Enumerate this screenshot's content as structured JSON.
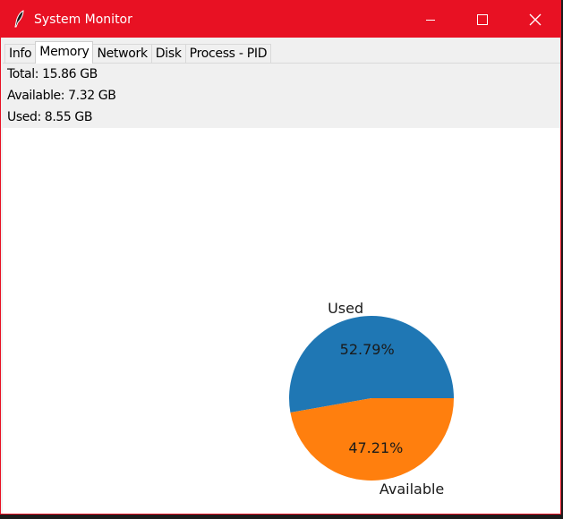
{
  "window": {
    "title": "System Monitor",
    "titlebar_color": "#e81123"
  },
  "tabs": [
    {
      "label": "Info",
      "active": false
    },
    {
      "label": "Memory",
      "active": true
    },
    {
      "label": "Network",
      "active": false
    },
    {
      "label": "Disk",
      "active": false
    },
    {
      "label": "Process - PID",
      "active": false
    }
  ],
  "memory": {
    "total": "Total: 15.86 GB",
    "available": "Available: 7.32 GB",
    "used": "Used: 8.55 GB"
  },
  "chart_data": {
    "type": "pie",
    "categories": [
      "Used",
      "Available"
    ],
    "values": [
      52.79,
      47.21
    ],
    "value_labels": [
      "52.79%",
      "47.21%"
    ],
    "colors": [
      "#1f77b4",
      "#ff7f0e"
    ]
  }
}
